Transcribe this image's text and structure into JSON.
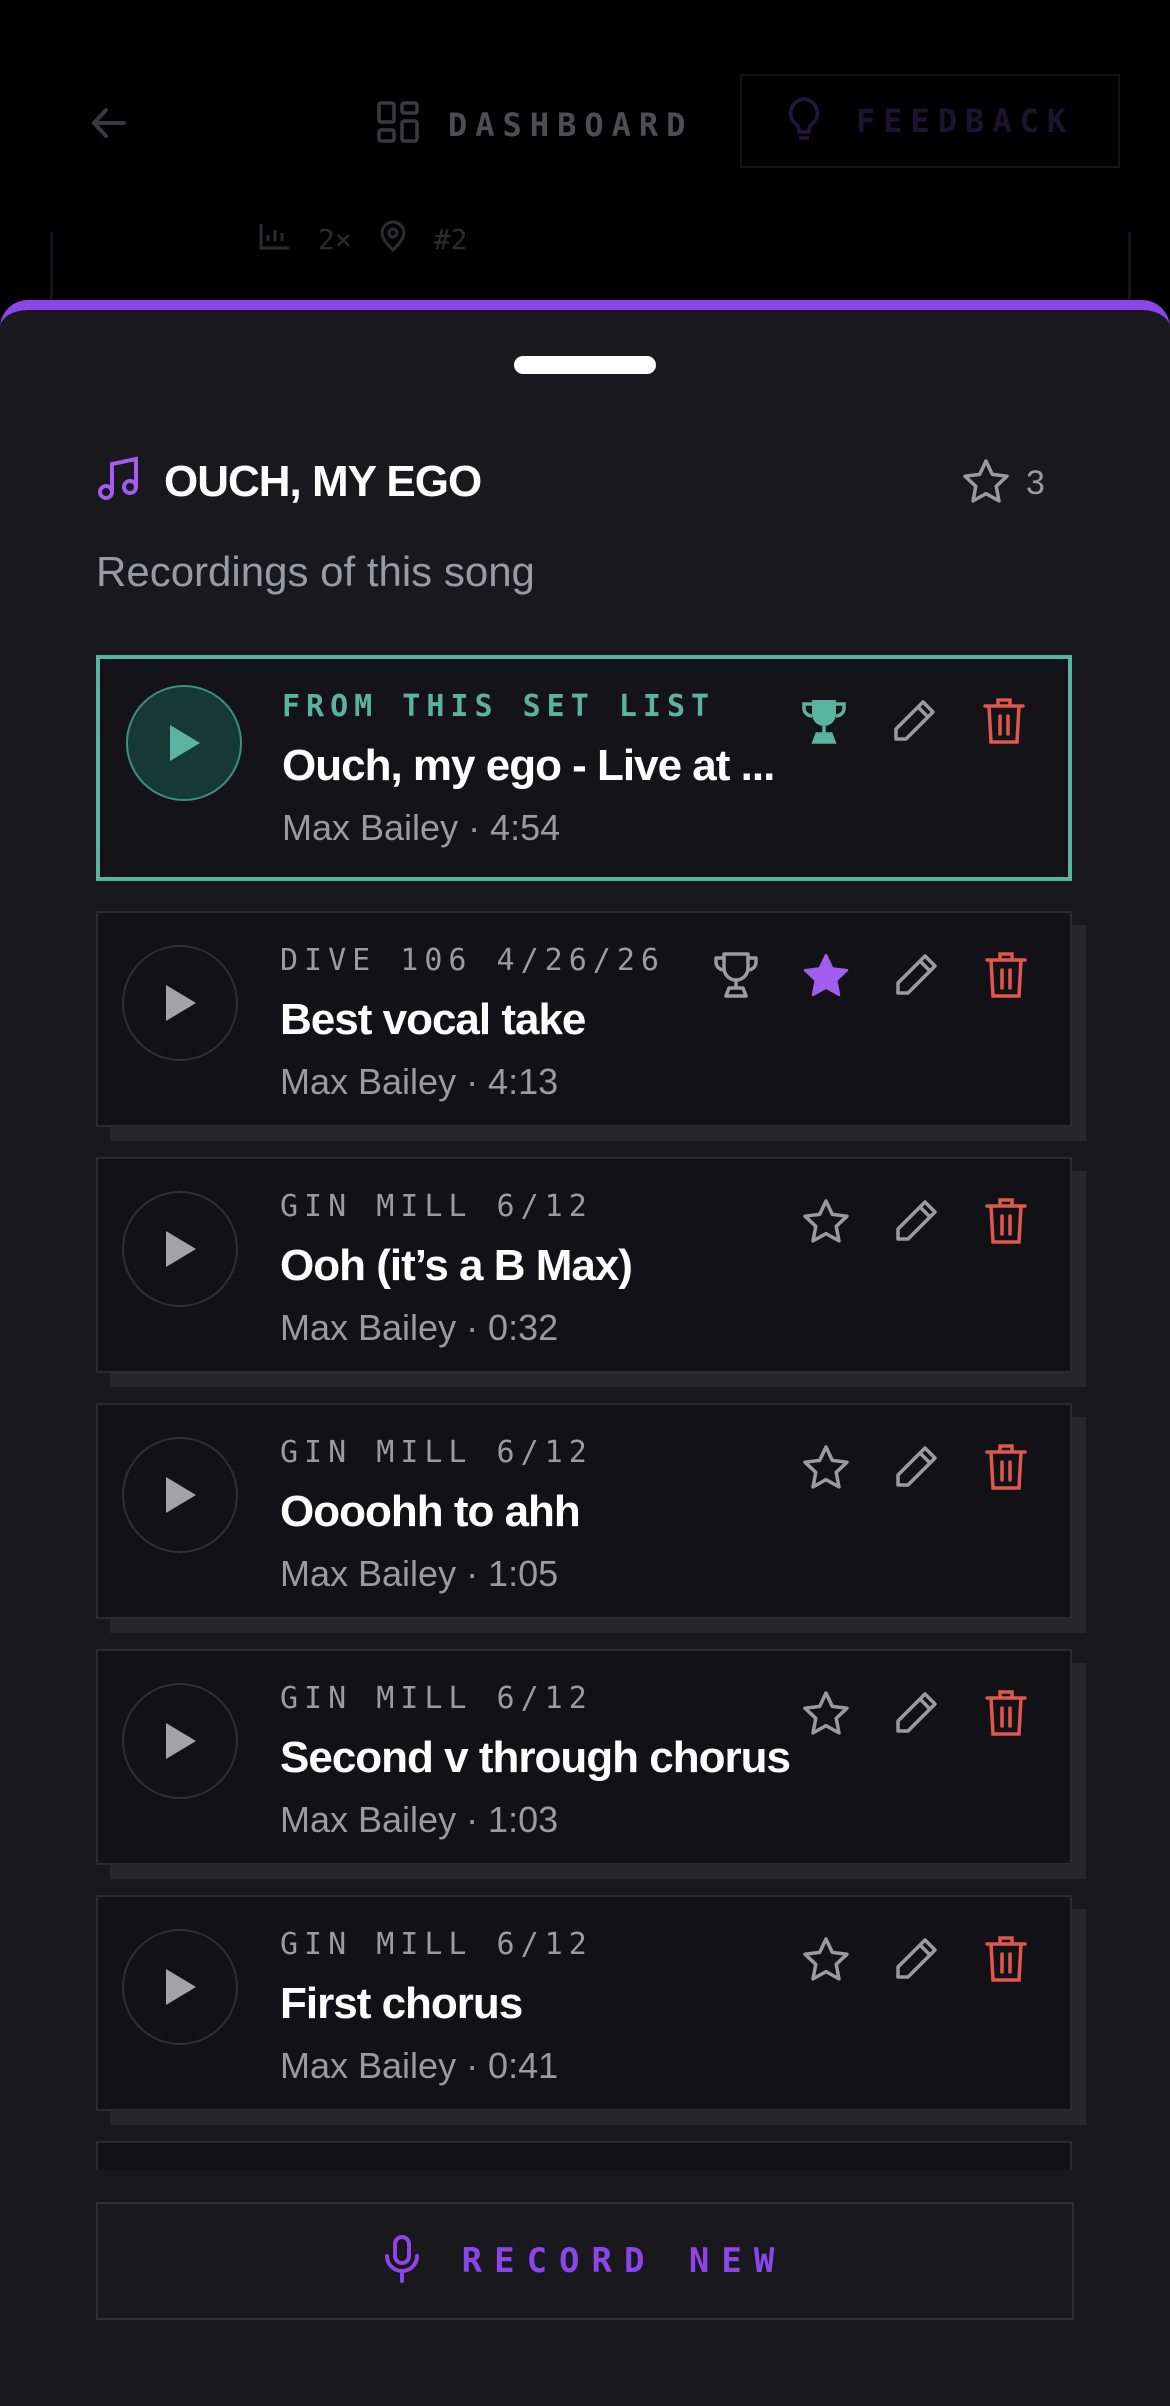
{
  "header": {
    "dashboard_label": "DASHBOARD",
    "feedback_label": "FEEDBACK",
    "behind_meta": [
      "2×",
      "#2"
    ]
  },
  "song": {
    "title": "OUCH, MY EGO",
    "favorites_count": "3",
    "subtitle": "Recordings of this song"
  },
  "recordings": [
    {
      "meta": "FROM THIS SET LIST",
      "name": "Ouch, my ego - Live at ...",
      "sub": "Max Bailey · 4:54",
      "active": true,
      "best": true,
      "starred": null
    },
    {
      "meta": "DIVE 106 4/26/26",
      "name": "Best vocal take",
      "sub": "Max Bailey · 4:13",
      "active": false,
      "best": false,
      "starred": true
    },
    {
      "meta": "GIN MILL 6/12",
      "name": "Ooh (it’s a B Max)",
      "sub": "Max Bailey · 0:32",
      "active": false,
      "starred": false
    },
    {
      "meta": "GIN MILL 6/12",
      "name": "Oooohh to ahh",
      "sub": "Max Bailey · 1:05",
      "active": false,
      "starred": false
    },
    {
      "meta": "GIN MILL 6/12",
      "name": "Second v through chorus",
      "sub": "Max Bailey · 1:03",
      "active": false,
      "starred": false
    },
    {
      "meta": "GIN MILL 6/12",
      "name": "First chorus",
      "sub": "Max Bailey · 0:41",
      "active": false,
      "starred": false
    }
  ],
  "record_button_label": "RECORD NEW",
  "colors": {
    "accent": "#8b45e8",
    "teal": "#5ab3a0",
    "delete": "#e0574f"
  }
}
